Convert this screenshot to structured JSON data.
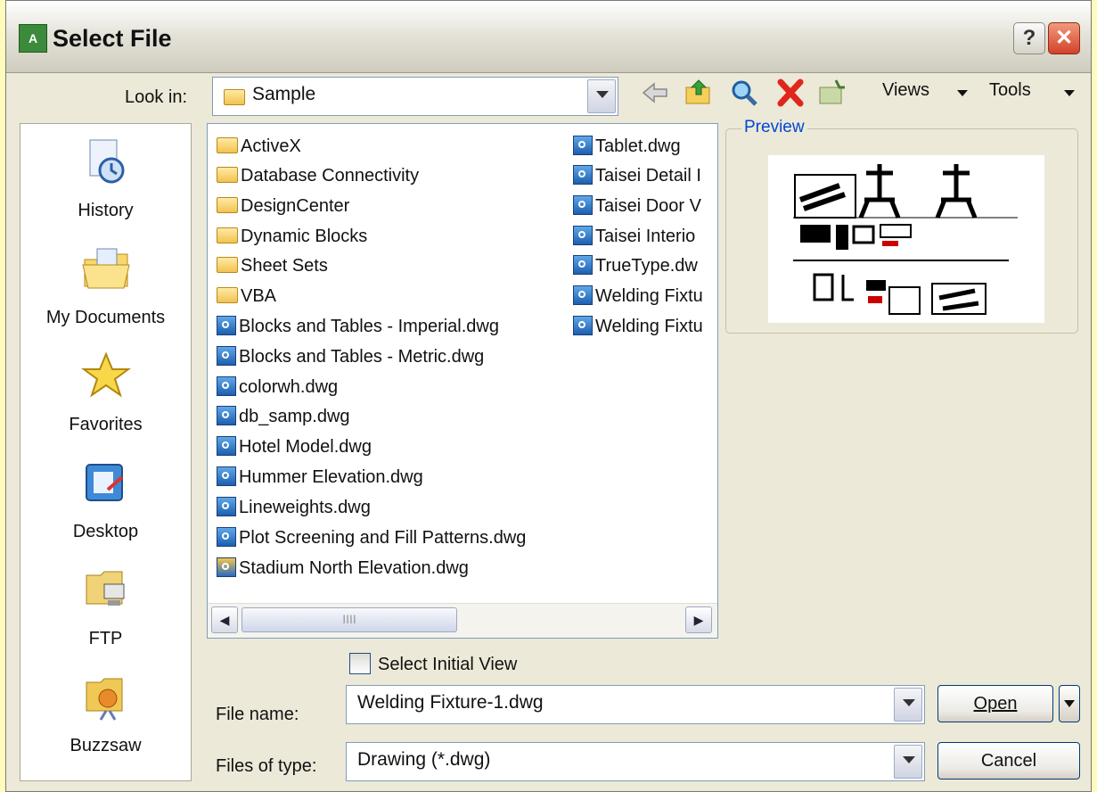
{
  "window": {
    "title": "Select File",
    "help_label": "?",
    "close_label": "✕"
  },
  "look_in": {
    "label": "Look in:",
    "value": "Sample"
  },
  "toolbar": {
    "views_label": "Views",
    "tools_label": "Tools"
  },
  "places": [
    {
      "label": "History",
      "icon": "history-icon"
    },
    {
      "label": "My Documents",
      "icon": "my-documents-icon"
    },
    {
      "label": "Favorites",
      "icon": "favorites-star-icon"
    },
    {
      "label": "Desktop",
      "icon": "desktop-icon"
    },
    {
      "label": "FTP",
      "icon": "ftp-icon"
    },
    {
      "label": "Buzzsaw",
      "icon": "buzzsaw-icon"
    }
  ],
  "files": {
    "column1": [
      {
        "name": "ActiveX",
        "type": "folder"
      },
      {
        "name": "Database Connectivity",
        "type": "folder"
      },
      {
        "name": "DesignCenter",
        "type": "folder"
      },
      {
        "name": "Dynamic Blocks",
        "type": "folder"
      },
      {
        "name": "Sheet Sets",
        "type": "folder"
      },
      {
        "name": "VBA",
        "type": "folder"
      },
      {
        "name": "Blocks and Tables - Imperial.dwg",
        "type": "dwg"
      },
      {
        "name": "Blocks and Tables - Metric.dwg",
        "type": "dwg"
      },
      {
        "name": "colorwh.dwg",
        "type": "dwg"
      },
      {
        "name": "db_samp.dwg",
        "type": "dwg"
      },
      {
        "name": "Hotel Model.dwg",
        "type": "dwg"
      },
      {
        "name": "Hummer Elevation.dwg",
        "type": "dwg"
      },
      {
        "name": "Lineweights.dwg",
        "type": "dwg"
      },
      {
        "name": "Plot Screening and Fill Patterns.dwg",
        "type": "dwg"
      },
      {
        "name": "Stadium North Elevation.dwg",
        "type": "dwg-stadium"
      }
    ],
    "column2": [
      {
        "name": "Tablet.dwg",
        "type": "dwg"
      },
      {
        "name": "Taisei Detail I",
        "type": "dwg"
      },
      {
        "name": "Taisei Door V",
        "type": "dwg"
      },
      {
        "name": "Taisei Interio",
        "type": "dwg"
      },
      {
        "name": "TrueType.dw",
        "type": "dwg"
      },
      {
        "name": "Welding Fixtu",
        "type": "dwg"
      },
      {
        "name": "Welding Fixtu",
        "type": "dwg"
      }
    ]
  },
  "scrollbar": {
    "left_arrow": "◀",
    "right_arrow": "▶",
    "thumb_grip": "IIII"
  },
  "preview": {
    "legend": "Preview"
  },
  "select_initial_view": {
    "label": "Select Initial View",
    "checked": false
  },
  "file_name": {
    "label": "File name:",
    "value": "Welding Fixture-1.dwg"
  },
  "files_of_type": {
    "label": "Files of type:",
    "value": "Drawing (*.dwg)"
  },
  "buttons": {
    "open": "Open",
    "cancel": "Cancel"
  },
  "colors": {
    "dialog_bg": "#ece9d8",
    "preview_legend": "#0046d5",
    "frame_bg": "#fffbbd"
  }
}
